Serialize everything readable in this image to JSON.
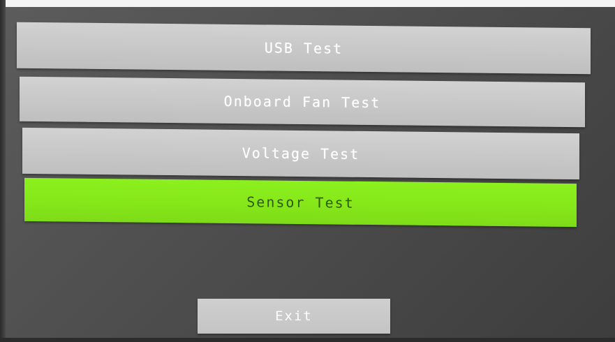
{
  "menu": {
    "items": [
      {
        "label": "USB Test",
        "selected": false
      },
      {
        "label": "Onboard Fan Test",
        "selected": false
      },
      {
        "label": "Voltage Test",
        "selected": false
      },
      {
        "label": "Sensor Test",
        "selected": true
      }
    ]
  },
  "exit": {
    "label": "Exit"
  },
  "colors": {
    "item_bg": "#c8c8c8",
    "selected_bg": "#86e81a",
    "selected_text": "#2f5a0a",
    "screen_bg": "#4e4e4e"
  }
}
